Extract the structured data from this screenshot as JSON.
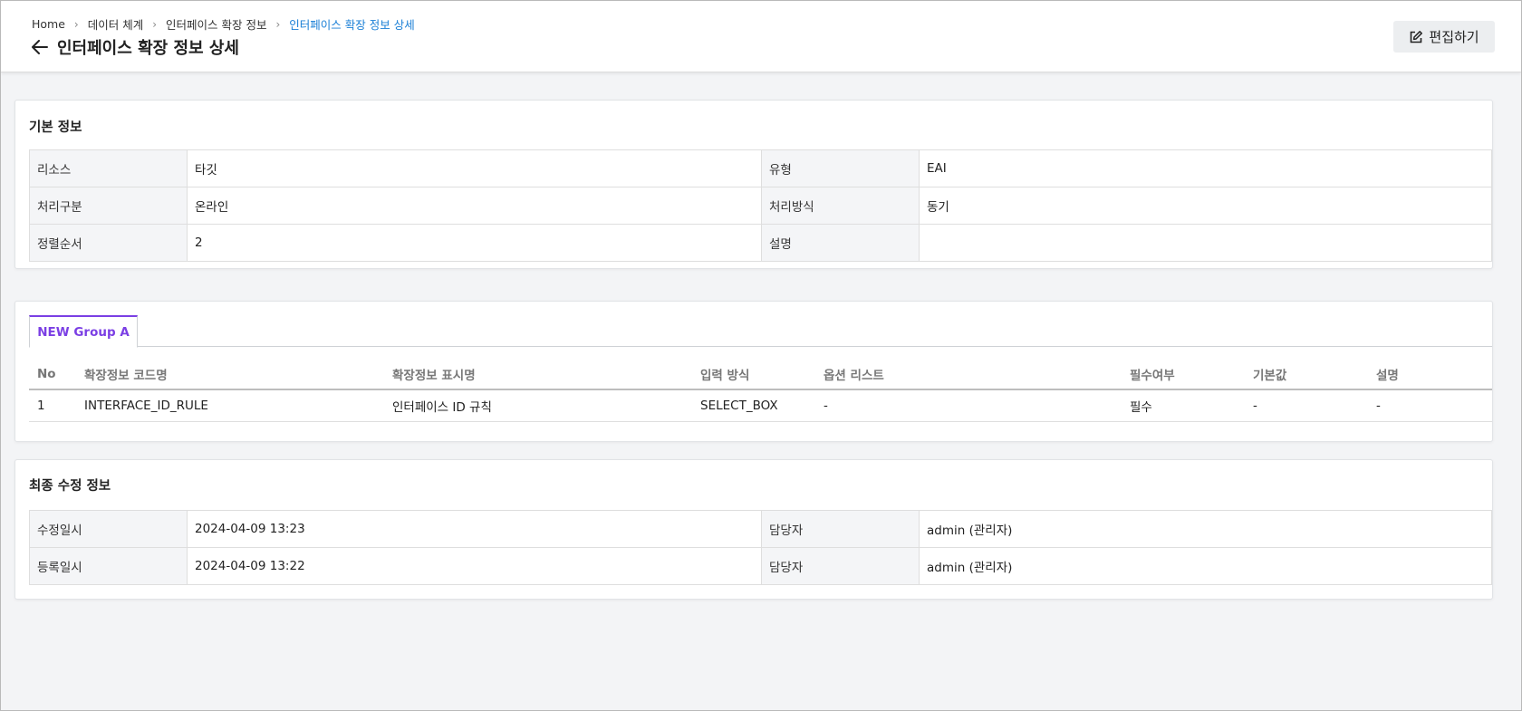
{
  "breadcrumb": [
    "Home",
    "데이터 체계",
    "인터페이스 확장 정보",
    "인터페이스 확장 정보 상세"
  ],
  "header": {
    "title": "인터페이스 확장 정보 상세",
    "edit_label": "편집하기",
    "back_icon": "arrow-left-icon",
    "edit_icon": "edit-icon"
  },
  "basic_info": {
    "title": "기본 정보",
    "rows": [
      {
        "label1": "리소스",
        "value1": "타깃",
        "label2": "유형",
        "value2": "EAI"
      },
      {
        "label1": "처리구분",
        "value1": "온라인",
        "label2": "처리방식",
        "value2": "동기"
      },
      {
        "label1": "정렬순서",
        "value1": "2",
        "label2": "설명",
        "value2": ""
      }
    ]
  },
  "group": {
    "tab_label": "NEW Group A",
    "columns": [
      "No",
      "확장정보 코드명",
      "확장정보 표시명",
      "입력 방식",
      "옵션 리스트",
      "필수여부",
      "기본값",
      "설명"
    ],
    "rows": [
      [
        "1",
        "INTERFACE_ID_RULE",
        "인터페이스 ID 규칙",
        "SELECT_BOX",
        "-",
        "필수",
        "-",
        "-"
      ]
    ]
  },
  "modify_info": {
    "title": "최종 수정 정보",
    "rows": [
      {
        "label1": "수정일시",
        "value1": "2024-04-09 13:23",
        "label2": "담당자",
        "value2": "admin (관리자)"
      },
      {
        "label1": "등록일시",
        "value1": "2024-04-09 13:22",
        "label2": "담당자",
        "value2": "admin (관리자)"
      }
    ]
  },
  "colors": {
    "accent_tab": "#7b3fe4",
    "breadcrumb_current": "#1a7fd6"
  }
}
